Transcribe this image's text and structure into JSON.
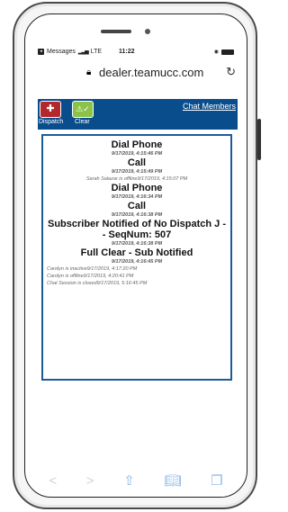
{
  "status_bar": {
    "carrier": "Messages",
    "network": "LTE",
    "time": "11:22"
  },
  "browser": {
    "url": "dealer.teamucc.com"
  },
  "app_bar": {
    "dispatch_label": "Dispatch",
    "clear_label": "Clear",
    "chat_members_label": "Chat Members"
  },
  "log": {
    "entries": [
      {
        "title": "Dial Phone",
        "time": "9/17/2019, 4:15:46 PM"
      },
      {
        "title": "Call",
        "time": "9/17/2019, 4:15:49 PM"
      },
      {
        "status": "Sarah Salazar is offline9/17/2019, 4:15:07 PM"
      },
      {
        "title": "Dial Phone",
        "time": "9/17/2019, 4:16:34 PM"
      },
      {
        "title": "Call",
        "time": "9/17/2019, 4:16:38 PM"
      },
      {
        "title_line1": "Subscriber Notified of No Dispatch J -",
        "title_line2": "- SeqNum: 507",
        "time": "9/17/2019, 4:16:38 PM"
      },
      {
        "title": "Full Clear - Sub Notified",
        "time": "9/17/2019, 4:16:45 PM"
      }
    ],
    "statuses": [
      "Carolyn is inactive9/17/2019, 4:17:20 PM",
      "Carolyn is offline9/17/2019, 4:20:41 PM",
      "Chat Session is closed9/17/2019, 5:16:45 PM"
    ]
  },
  "toolbar": {
    "back_icon": "chevron-left-icon",
    "forward_icon": "chevron-right-icon",
    "share_icon": "share-icon",
    "bookmarks_icon": "book-icon",
    "tabs_icon": "tabs-icon"
  }
}
